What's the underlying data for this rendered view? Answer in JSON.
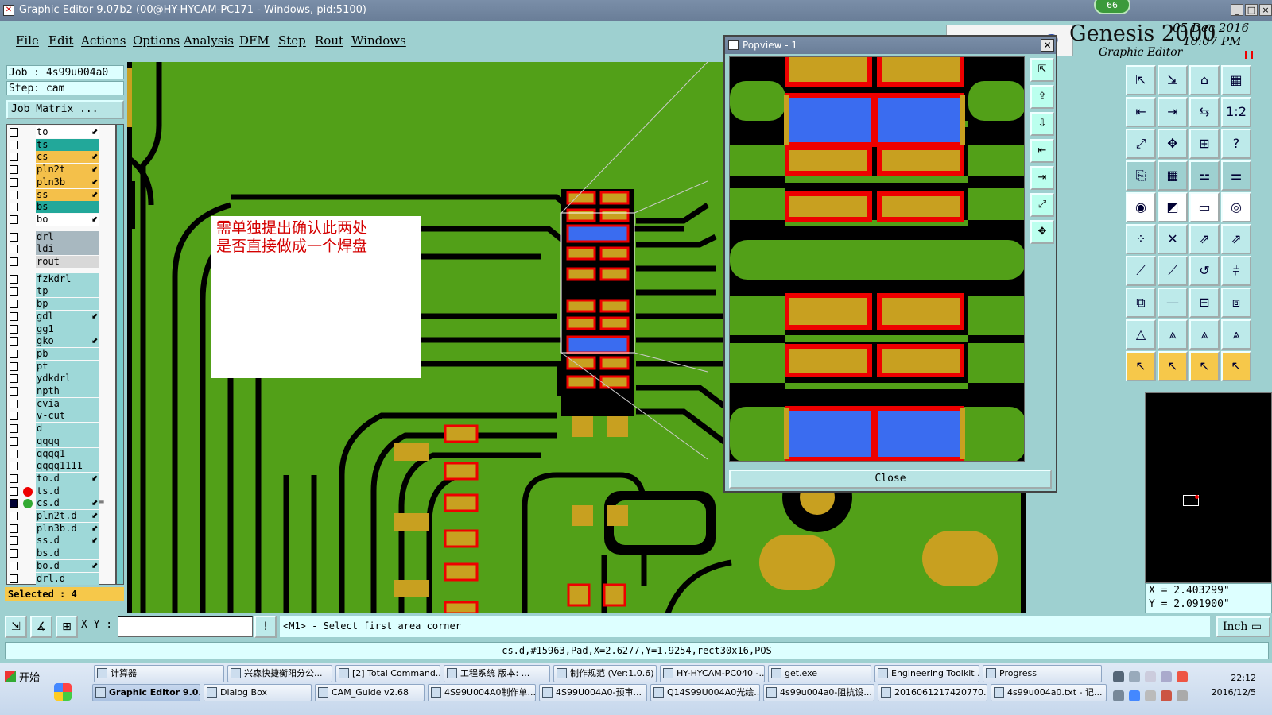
{
  "window": {
    "title": "Graphic Editor 9.07b2 (00@HY-HYCAM-PC171 - Windows, pid:5100)",
    "badge": "66",
    "controls": {
      "minimize": "_",
      "maximize": "□",
      "close": "×"
    }
  },
  "menu": [
    "File",
    "Edit",
    "Actions",
    "Options",
    "Analysis",
    "DFM",
    "Step",
    "Rout",
    "Windows"
  ],
  "brand": {
    "name": "Genesis 2000",
    "subtitle": "Graphic Editor",
    "date": "05 Dec 2016",
    "time": "10:07 PM"
  },
  "job": {
    "job_line": "Job : 4s99u004a0",
    "step_line": "Step: cam",
    "matrix_button": "Job Matrix ..."
  },
  "layers": [
    {
      "name": "to",
      "color": "#ffffff",
      "tag": "⬋"
    },
    {
      "name": "ts",
      "color": "#22a89a",
      "tag": ""
    },
    {
      "name": "cs",
      "color": "#f4c04a",
      "tag": "⬋"
    },
    {
      "name": "pln2t",
      "color": "#f4c04a",
      "tag": "⬋"
    },
    {
      "name": "pln3b",
      "color": "#f4c04a",
      "tag": "⬋"
    },
    {
      "name": "ss",
      "color": "#f4c04a",
      "tag": "⬋"
    },
    {
      "name": "bs",
      "color": "#22a89a",
      "tag": ""
    },
    {
      "name": "bo",
      "color": "#ffffff",
      "tag": "⬋"
    },
    {
      "name": "drl",
      "color": "#a8b8c0",
      "tag": ""
    },
    {
      "name": "ldi",
      "color": "#a8b8c0",
      "tag": ""
    },
    {
      "name": "rout",
      "color": "#d8d8d8",
      "tag": ""
    },
    {
      "name": "fzkdrl",
      "color": "#9ed8d8",
      "tag": ""
    },
    {
      "name": "tp",
      "color": "#9ed8d8",
      "tag": ""
    },
    {
      "name": "bp",
      "color": "#9ed8d8",
      "tag": ""
    },
    {
      "name": "gdl",
      "color": "#9ed8d8",
      "tag": "⬋"
    },
    {
      "name": "gg1",
      "color": "#9ed8d8",
      "tag": ""
    },
    {
      "name": "gko",
      "color": "#9ed8d8",
      "tag": "⬋"
    },
    {
      "name": "pb",
      "color": "#9ed8d8",
      "tag": ""
    },
    {
      "name": "pt",
      "color": "#9ed8d8",
      "tag": ""
    },
    {
      "name": "ydkdrl",
      "color": "#9ed8d8",
      "tag": ""
    },
    {
      "name": "npth",
      "color": "#9ed8d8",
      "tag": ""
    },
    {
      "name": "cvia",
      "color": "#9ed8d8",
      "tag": ""
    },
    {
      "name": "v-cut",
      "color": "#9ed8d8",
      "tag": ""
    },
    {
      "name": "d",
      "color": "#9ed8d8",
      "tag": ""
    },
    {
      "name": "qqqq",
      "color": "#9ed8d8",
      "tag": ""
    },
    {
      "name": "qqqq1",
      "color": "#9ed8d8",
      "tag": ""
    },
    {
      "name": "qqqq1111",
      "color": "#9ed8d8",
      "tag": ""
    },
    {
      "name": "to.d",
      "color": "#9ed8d8",
      "tag": "⬋"
    },
    {
      "name": "ts.d",
      "color": "#9ed8d8",
      "tag": ""
    },
    {
      "name": "cs.d",
      "color": "#9ed8d8",
      "tag": "⬋≡"
    },
    {
      "name": "pln2t.d",
      "color": "#9ed8d8",
      "tag": "⬋"
    },
    {
      "name": "pln3b.d",
      "color": "#9ed8d8",
      "tag": "⬋"
    },
    {
      "name": "ss.d",
      "color": "#9ed8d8",
      "tag": "⬋"
    },
    {
      "name": "bs.d",
      "color": "#9ed8d8",
      "tag": ""
    },
    {
      "name": "bo.d",
      "color": "#9ed8d8",
      "tag": "⬋"
    },
    {
      "name": "drl.d",
      "color": "#9ed8d8",
      "tag": ""
    }
  ],
  "selected": "Selected : 4",
  "note": {
    "line1": "需单独提出确认此两处",
    "line2": "是否直接做成一个焊盘"
  },
  "popview": {
    "title": "Popview - 1",
    "close_label": "Close"
  },
  "right_tools": [
    "⇱",
    "⇲",
    "⌂",
    "▦",
    "⇤",
    "⇥",
    "⇆",
    "1:2",
    "⤢",
    "✥",
    "⊞",
    "?",
    "⎘",
    "▦",
    "⚍",
    "⚌",
    "◉",
    "◩",
    "▭",
    "◎",
    "⁘",
    "✕",
    "⇗",
    "⇗",
    "⟋",
    "⟋",
    "↺",
    "⫩",
    "⧉",
    "—",
    "⊟",
    "⧈",
    "△",
    "⩓",
    "⩓",
    "⩓",
    "↖",
    "↖",
    "↖",
    "↖"
  ],
  "coords": {
    "x": "X = 2.403299\"",
    "y": "Y = 2.091900\""
  },
  "command": {
    "xy_label": "X Y :",
    "xy_value": "",
    "prompt": "<M1> - Select first area corner",
    "unit": "Inch"
  },
  "status_line": "cs.d,#15963,Pad,X=2.6277,Y=1.9254,rect30x16,POS",
  "taskbar": {
    "start": "开始",
    "row1": [
      "计算器",
      "兴森快捷衡阳分公...",
      "[2] Total Command...",
      "工程系统  版本: ...",
      "制作规范 (Ver:1.0.6)",
      "HY-HYCAM-PC040 -...",
      "get.exe",
      "Engineering Toolkit ...",
      "Progress"
    ],
    "row2": [
      "Graphic Editor 9.0...",
      "Dialog Box",
      "CAM_Guide v2.68",
      "4S99U004A0制作单...",
      "4S99U004A0-预审...",
      "Q14S99U004A0光绘...",
      "4s99u004a0-阻抗设...",
      "2016061217420770...",
      "4s99u004a0.txt - 记..."
    ],
    "clock_time": "22:12",
    "clock_date": "2016/12/5"
  }
}
